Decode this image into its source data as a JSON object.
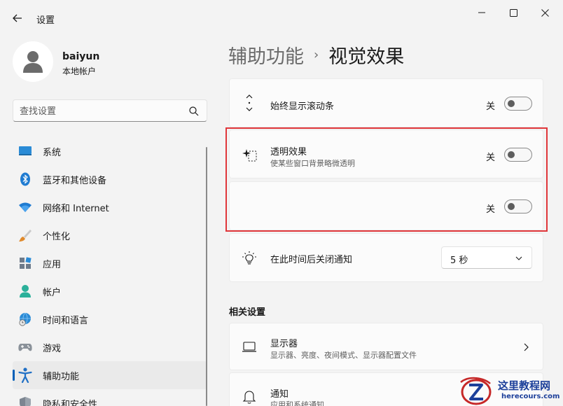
{
  "window": {
    "title": "设置"
  },
  "profile": {
    "name": "baiyun",
    "account_type": "本地帐户"
  },
  "search": {
    "placeholder": "查找设置"
  },
  "sidebar": {
    "items": [
      {
        "label": "系统",
        "icon": "system-icon"
      },
      {
        "label": "蓝牙和其他设备",
        "icon": "bluetooth-icon"
      },
      {
        "label": "网络和 Internet",
        "icon": "wifi-icon"
      },
      {
        "label": "个性化",
        "icon": "brush-icon"
      },
      {
        "label": "应用",
        "icon": "apps-icon"
      },
      {
        "label": "帐户",
        "icon": "account-icon"
      },
      {
        "label": "时间和语言",
        "icon": "globe-clock-icon"
      },
      {
        "label": "游戏",
        "icon": "gamepad-icon"
      },
      {
        "label": "辅助功能",
        "icon": "accessibility-icon",
        "active": true
      },
      {
        "label": "隐私和安全性",
        "icon": "shield-icon"
      }
    ]
  },
  "breadcrumb": {
    "parent": "辅助功能",
    "separator": "›",
    "current": "视觉效果"
  },
  "settings": {
    "scrollbars": {
      "title": "始终显示滚动条",
      "state": "关",
      "on": false
    },
    "transparency": {
      "title": "透明效果",
      "description": "使某些窗口背景略微透明",
      "state": "关",
      "on": false
    },
    "animation": {
      "state": "关",
      "on": false
    },
    "notifications": {
      "title": "在此时间后关闭通知",
      "value": "5 秒"
    }
  },
  "related": {
    "heading": "相关设置",
    "items": [
      {
        "title": "显示器",
        "description": "显示器、亮度、夜间模式、显示器配置文件"
      },
      {
        "title": "通知",
        "description": "应用和系统通知"
      }
    ]
  },
  "watermark": {
    "line1": "这里教程网",
    "line2": "herecours.com"
  },
  "colors": {
    "accent": "#005fb8",
    "highlight_border": "#e0363a",
    "background": "#f3f3f3",
    "card": "#fbfbfb"
  }
}
